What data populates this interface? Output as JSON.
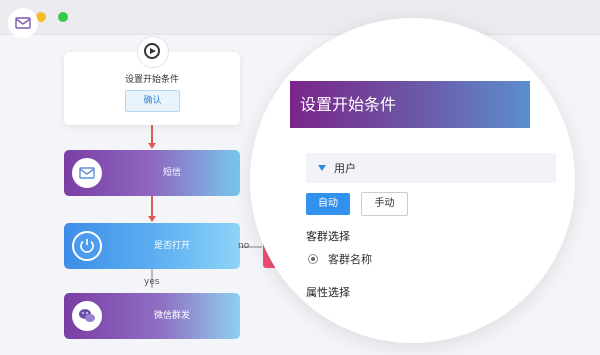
{
  "window": {
    "traffic_lights": [
      "close",
      "minimize",
      "maximize"
    ]
  },
  "flow": {
    "start": {
      "title": "设置开始条件",
      "confirm_label": "确认"
    },
    "nodes": [
      {
        "id": "sms",
        "label": "短信",
        "icon": "mail-icon"
      },
      {
        "id": "open",
        "label": "是否打开",
        "icon": "power-icon"
      },
      {
        "id": "wechat",
        "label": "微信群发",
        "icon": "wechat-icon"
      },
      {
        "id": "email",
        "label": "",
        "icon": "email-icon"
      }
    ],
    "yes_label": "yes",
    "no_label": "no"
  },
  "panel": {
    "title": "设置开始条件",
    "user_section": "用户",
    "mode_buttons": [
      "自动",
      "手动"
    ],
    "selected_mode": "自动",
    "customer_group_title": "客群选择",
    "customer_group_option": "客群名称",
    "attribute_title": "属性选择"
  },
  "colors": {
    "accent_blue": "#3291ee",
    "arrow_red": "#e05a54",
    "purple": "#7a3ea5",
    "branch_red": "#ef4f72"
  }
}
